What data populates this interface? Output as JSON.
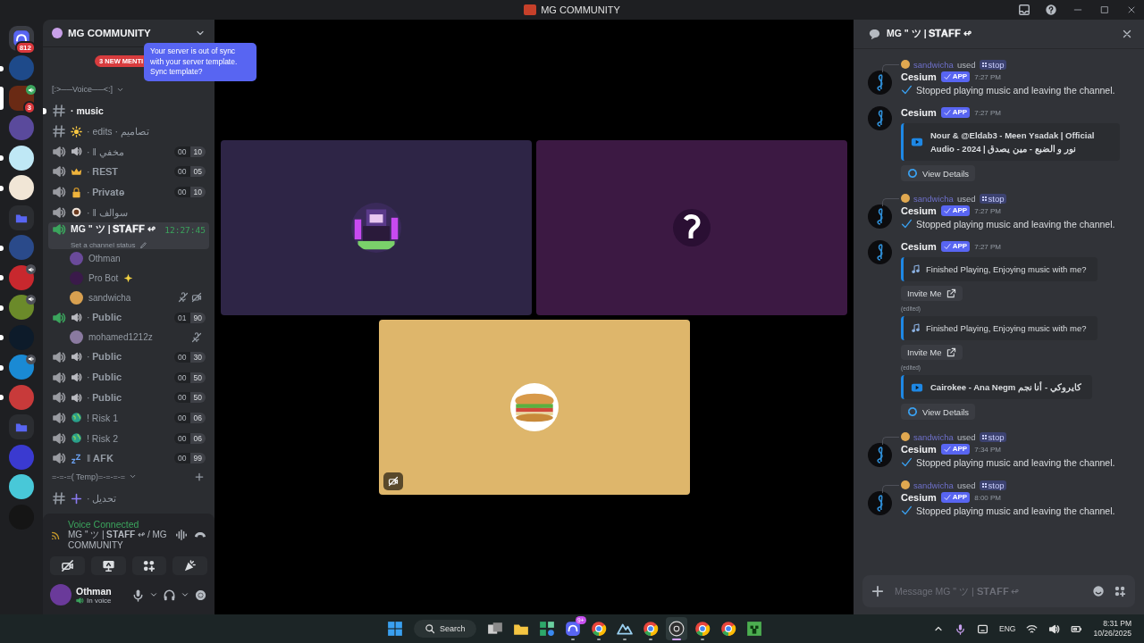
{
  "title_bar": {
    "title": "MG COMMUNITY"
  },
  "servers": [
    {
      "kind": "home",
      "badge": "812",
      "unread": false,
      "selected": false,
      "color": "#3a3c43"
    },
    {
      "kind": "server",
      "color": "#1e4a8a",
      "unread": true,
      "selected": false
    },
    {
      "kind": "server",
      "color": "#6a2a14",
      "badge": "3",
      "voice": true,
      "unread": false,
      "selected": true
    },
    {
      "kind": "server",
      "color": "#5a4a9c",
      "unread": false,
      "selected": false
    },
    {
      "kind": "server",
      "color": "#bfe8f5",
      "unread": true,
      "selected": false
    },
    {
      "kind": "server",
      "color": "#f1e6d6",
      "unread": true,
      "selected": false
    },
    {
      "kind": "folder",
      "color": "#5865f2",
      "unread": false,
      "selected": false
    },
    {
      "kind": "server",
      "color": "#2a4a8a",
      "unread": true,
      "selected": false
    },
    {
      "kind": "server",
      "color": "#c8282e",
      "voice": true,
      "unread": true,
      "selected": false
    },
    {
      "kind": "server",
      "color": "#6b8a2a",
      "voice": true,
      "unread": true,
      "selected": false
    },
    {
      "kind": "server",
      "color": "#0d1b2a",
      "unread": true,
      "selected": false
    },
    {
      "kind": "server",
      "color": "#1a8ad4",
      "voice": true,
      "unread": true,
      "selected": false
    },
    {
      "kind": "server",
      "color": "#c83a3a",
      "unread": true,
      "selected": false
    },
    {
      "kind": "folder",
      "color": "#5865f2",
      "unread": false,
      "selected": false
    },
    {
      "kind": "server",
      "color": "#3a3ad0",
      "unread": false,
      "selected": false
    },
    {
      "kind": "server",
      "color": "#48c8d8",
      "unread": false,
      "selected": false
    },
    {
      "kind": "server",
      "color": "#151515",
      "unread": false,
      "selected": false
    }
  ],
  "sidebar": {
    "server_name": "MG COMMUNITY",
    "mentions": "3 NEW MENTI",
    "tooltip": "Your server is out of sync with your server template. Sync template?",
    "channels": [
      {
        "kind": "category",
        "name": "[:>──Voice──<:]"
      },
      {
        "kind": "text",
        "name": "· music",
        "unread": true
      },
      {
        "kind": "text",
        "name": "· edits · تصاميم",
        "unread": false
      },
      {
        "kind": "voice",
        "name": "· ‖ مخفي",
        "count": "00",
        "limit": "10",
        "active": false
      },
      {
        "kind": "voice",
        "name": "· 𝐑𝐄𝐒𝐓",
        "count": "00",
        "limit": "05",
        "active": false
      },
      {
        "kind": "voice",
        "name": "· 𝐏𝐫𝐢𝐯𝐚𝐭𝐞",
        "count": "00",
        "limit": "10",
        "active": false
      },
      {
        "kind": "voice",
        "name": "· ‖ سوالف",
        "active": false
      },
      {
        "kind": "voice",
        "name": "MG \" ツ | 𝐒𝐓𝐀𝐅𝐅 ↫",
        "timer": "12:27:45",
        "status": "Set a channel status",
        "active": true,
        "selected": true
      },
      {
        "kind": "member",
        "name": "Othman",
        "color": "#6a4a9a",
        "muted": false,
        "deafened": false
      },
      {
        "kind": "member",
        "name": "Pro Bot",
        "color": "#3a1a4a",
        "muted": false,
        "deafened": false
      },
      {
        "kind": "member",
        "name": "sandwicha",
        "color": "#d8a050",
        "muted": true,
        "deafened": true
      },
      {
        "kind": "voice",
        "name": "· 𝐏𝐮𝐛𝐥𝐢𝐜",
        "count": "01",
        "limit": "90",
        "active": true
      },
      {
        "kind": "member",
        "name": "mohamed1212z",
        "color": "#8a7aa0",
        "muted": true,
        "deafened": false
      },
      {
        "kind": "voice",
        "name": "· 𝐏𝐮𝐛𝐥𝐢𝐜",
        "count": "00",
        "limit": "30",
        "active": false
      },
      {
        "kind": "voice",
        "name": "· 𝐏𝐮𝐛𝐥𝐢𝐜",
        "count": "00",
        "limit": "50",
        "active": false
      },
      {
        "kind": "voice",
        "name": "· 𝐏𝐮𝐛𝐥𝐢𝐜",
        "count": "00",
        "limit": "50",
        "active": false
      },
      {
        "kind": "voice",
        "name": "! Risk 1",
        "count": "00",
        "limit": "06",
        "active": false
      },
      {
        "kind": "voice",
        "name": "! Risk 2",
        "count": "00",
        "limit": "06",
        "active": false
      },
      {
        "kind": "voice",
        "name": "‖ 𝐀𝐅𝐊",
        "count": "00",
        "limit": "99",
        "active": false
      },
      {
        "kind": "category",
        "name": "=-=-=( Temp)=-=-=-="
      },
      {
        "kind": "text",
        "name": "· تحديل",
        "unread": false
      }
    ]
  },
  "voice_panel": {
    "state": "Voice Connected",
    "location": "MG \" ツ | 𝐒𝐓𝐀𝐅𝐅 ↫ / MG COMMUNITY"
  },
  "user": {
    "name": "Othman",
    "status": "In voice"
  },
  "stage": {
    "tiles": [
      {
        "color": "#2e2546",
        "muted_video": false
      },
      {
        "color": "#3c1943",
        "muted_video": false
      },
      {
        "color": "#deb66b",
        "muted_video": true
      }
    ]
  },
  "chat": {
    "title": "MG \" ツ | 𝐒𝐓𝐀𝐅𝐅 ↫",
    "placeholder": "Message MG \" ツ | 𝐒𝐓𝐀𝐅𝐅 ↫",
    "messages": [
      {
        "interaction": {
          "user": "sandwicha",
          "verb": "used",
          "command": "stop"
        },
        "author": "Cesium",
        "tag": "APP",
        "time": "7:27 PM",
        "parts": [
          {
            "kind": "text",
            "text": "Stopped playing music and leaving the channel."
          }
        ]
      },
      {
        "author": "Cesium",
        "tag": "APP",
        "time": "7:27 PM",
        "parts": [
          {
            "kind": "video-embed",
            "text": "Nour & @Eldab3 - Meen Ysadak | Official Audio - 2024 | نور و الضبع - مين يصدق"
          },
          {
            "kind": "details-button",
            "text": "View Details"
          }
        ]
      },
      {
        "interaction": {
          "user": "sandwicha",
          "verb": "used",
          "command": "stop"
        },
        "author": "Cesium",
        "tag": "APP",
        "time": "7:27 PM",
        "parts": [
          {
            "kind": "text",
            "text": "Stopped playing music and leaving the channel."
          }
        ]
      },
      {
        "author": "Cesium",
        "tag": "APP",
        "time": "7:27 PM",
        "parts": [
          {
            "kind": "music-embed",
            "text": "Finished Playing, Enjoying music with me?"
          },
          {
            "kind": "invite-button",
            "text": "Invite Me"
          },
          {
            "kind": "edited",
            "text": "(edited)"
          },
          {
            "kind": "music-embed",
            "text": "Finished Playing, Enjoying music with me?"
          },
          {
            "kind": "invite-button",
            "text": "Invite Me"
          },
          {
            "kind": "edited",
            "text": "(edited)"
          },
          {
            "kind": "video-embed",
            "text": "Cairokee - Ana Negm كايروكي - أنا نجم"
          },
          {
            "kind": "details-button",
            "text": "View Details"
          }
        ]
      },
      {
        "interaction": {
          "user": "sandwicha",
          "verb": "used",
          "command": "stop"
        },
        "author": "Cesium",
        "tag": "APP",
        "time": "7:34 PM",
        "parts": [
          {
            "kind": "text",
            "text": "Stopped playing music and leaving the channel."
          }
        ]
      },
      {
        "interaction": {
          "user": "sandwicha",
          "verb": "used",
          "command": "stop"
        },
        "author": "Cesium",
        "tag": "APP",
        "time": "8:00 PM",
        "parts": [
          {
            "kind": "text",
            "text": "Stopped playing music and leaving the channel."
          }
        ]
      }
    ]
  },
  "taskbar": {
    "search": "Search",
    "apps": [
      {
        "running": false,
        "active": false
      },
      {
        "running": false,
        "active": false
      },
      {
        "running": false,
        "active": false
      },
      {
        "running": true,
        "active": false,
        "badge": "9+"
      },
      {
        "running": true,
        "active": false
      },
      {
        "running": true,
        "active": false
      },
      {
        "running": true,
        "active": false
      },
      {
        "running": true,
        "active": true
      },
      {
        "running": true,
        "active": false
      },
      {
        "running": false,
        "active": false
      },
      {
        "running": false,
        "active": false
      }
    ],
    "language": "ENG",
    "time": "8:31 PM",
    "date": "10/26/2025"
  }
}
